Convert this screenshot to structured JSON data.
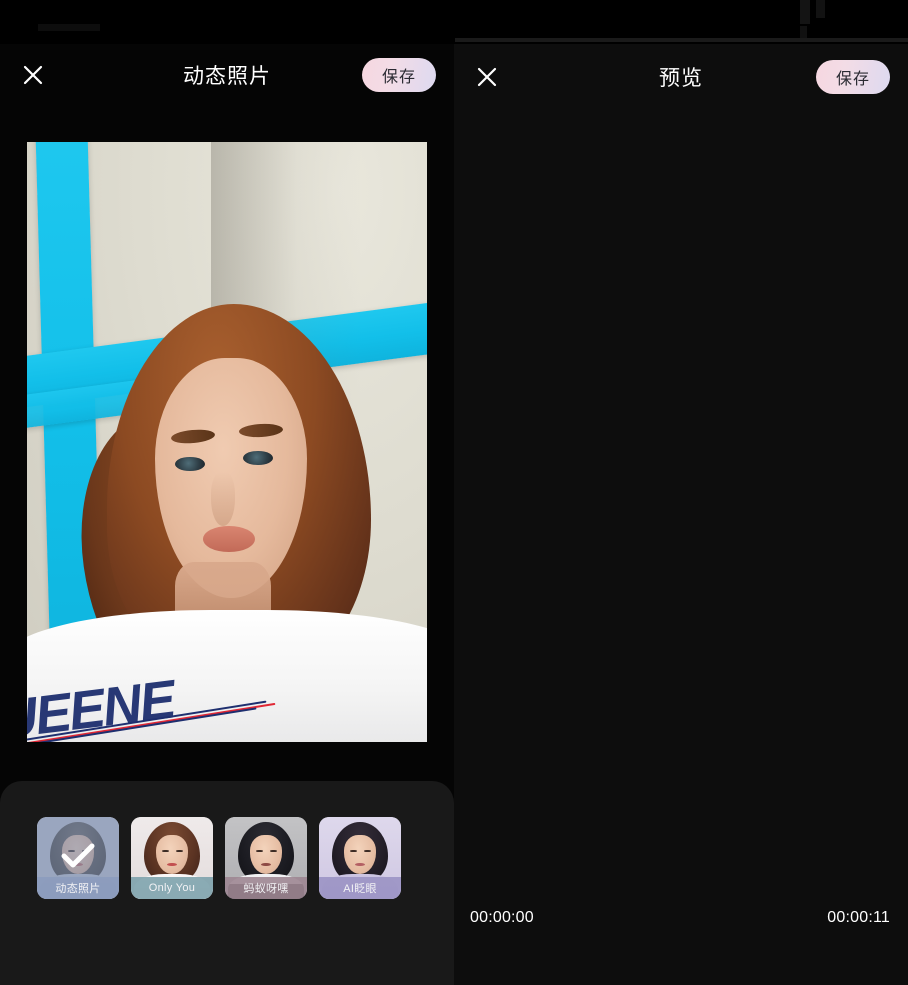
{
  "app": {
    "accent_gradient_from": "#f6d7e0",
    "accent_gradient_to": "#ddd9f0",
    "background": "#000000",
    "tray_background": "#191919"
  },
  "left_panel": {
    "title": "动态照片",
    "close_label": "关闭",
    "save_label": "保存",
    "close_icon": "close-icon",
    "templates": [
      {
        "id": "dongtai-zhaopian",
        "label": "动态照片",
        "selected": true,
        "label_bar_color": "#8b9bbd",
        "thumb_bg": "#c6cbd8",
        "hair_color": "#5d5a56",
        "body_color": "#b9bfcd",
        "check_icon": "check-icon"
      },
      {
        "id": "only-you",
        "label": "Only You",
        "selected": false,
        "label_bar_color": "#7ba0ab",
        "thumb_bg": "#e9e4e4",
        "hair_color": "#5a3a2b",
        "body_color": "#f2eeee"
      },
      {
        "id": "mayi-yahei",
        "label": "蚂蚁呀嘿",
        "selected": false,
        "label_bar_color": "#9d8692",
        "thumb_bg": "#b9b9bb",
        "hair_color": "#1d1d22",
        "body_color": "#e8e8ea"
      },
      {
        "id": "ai-zhayan",
        "label": "AI眨眼",
        "selected": false,
        "label_bar_color": "#9b93c4",
        "thumb_bg": "#d9d3e8",
        "hair_color": "#262029",
        "body_color": "#c9c2e0"
      }
    ]
  },
  "right_panel": {
    "title": "预览",
    "close_label": "关闭",
    "save_label": "保存",
    "close_icon": "close-icon",
    "player": {
      "play_icon": "play-icon",
      "current_time": "00:00:00",
      "total_time": "00:00:11",
      "progress_percent": 0,
      "track_color": "#5b5b5b",
      "thumb_color": "#ffffff"
    }
  },
  "photo": {
    "description": "portrait-photo",
    "shirt_text": "UEENE"
  }
}
